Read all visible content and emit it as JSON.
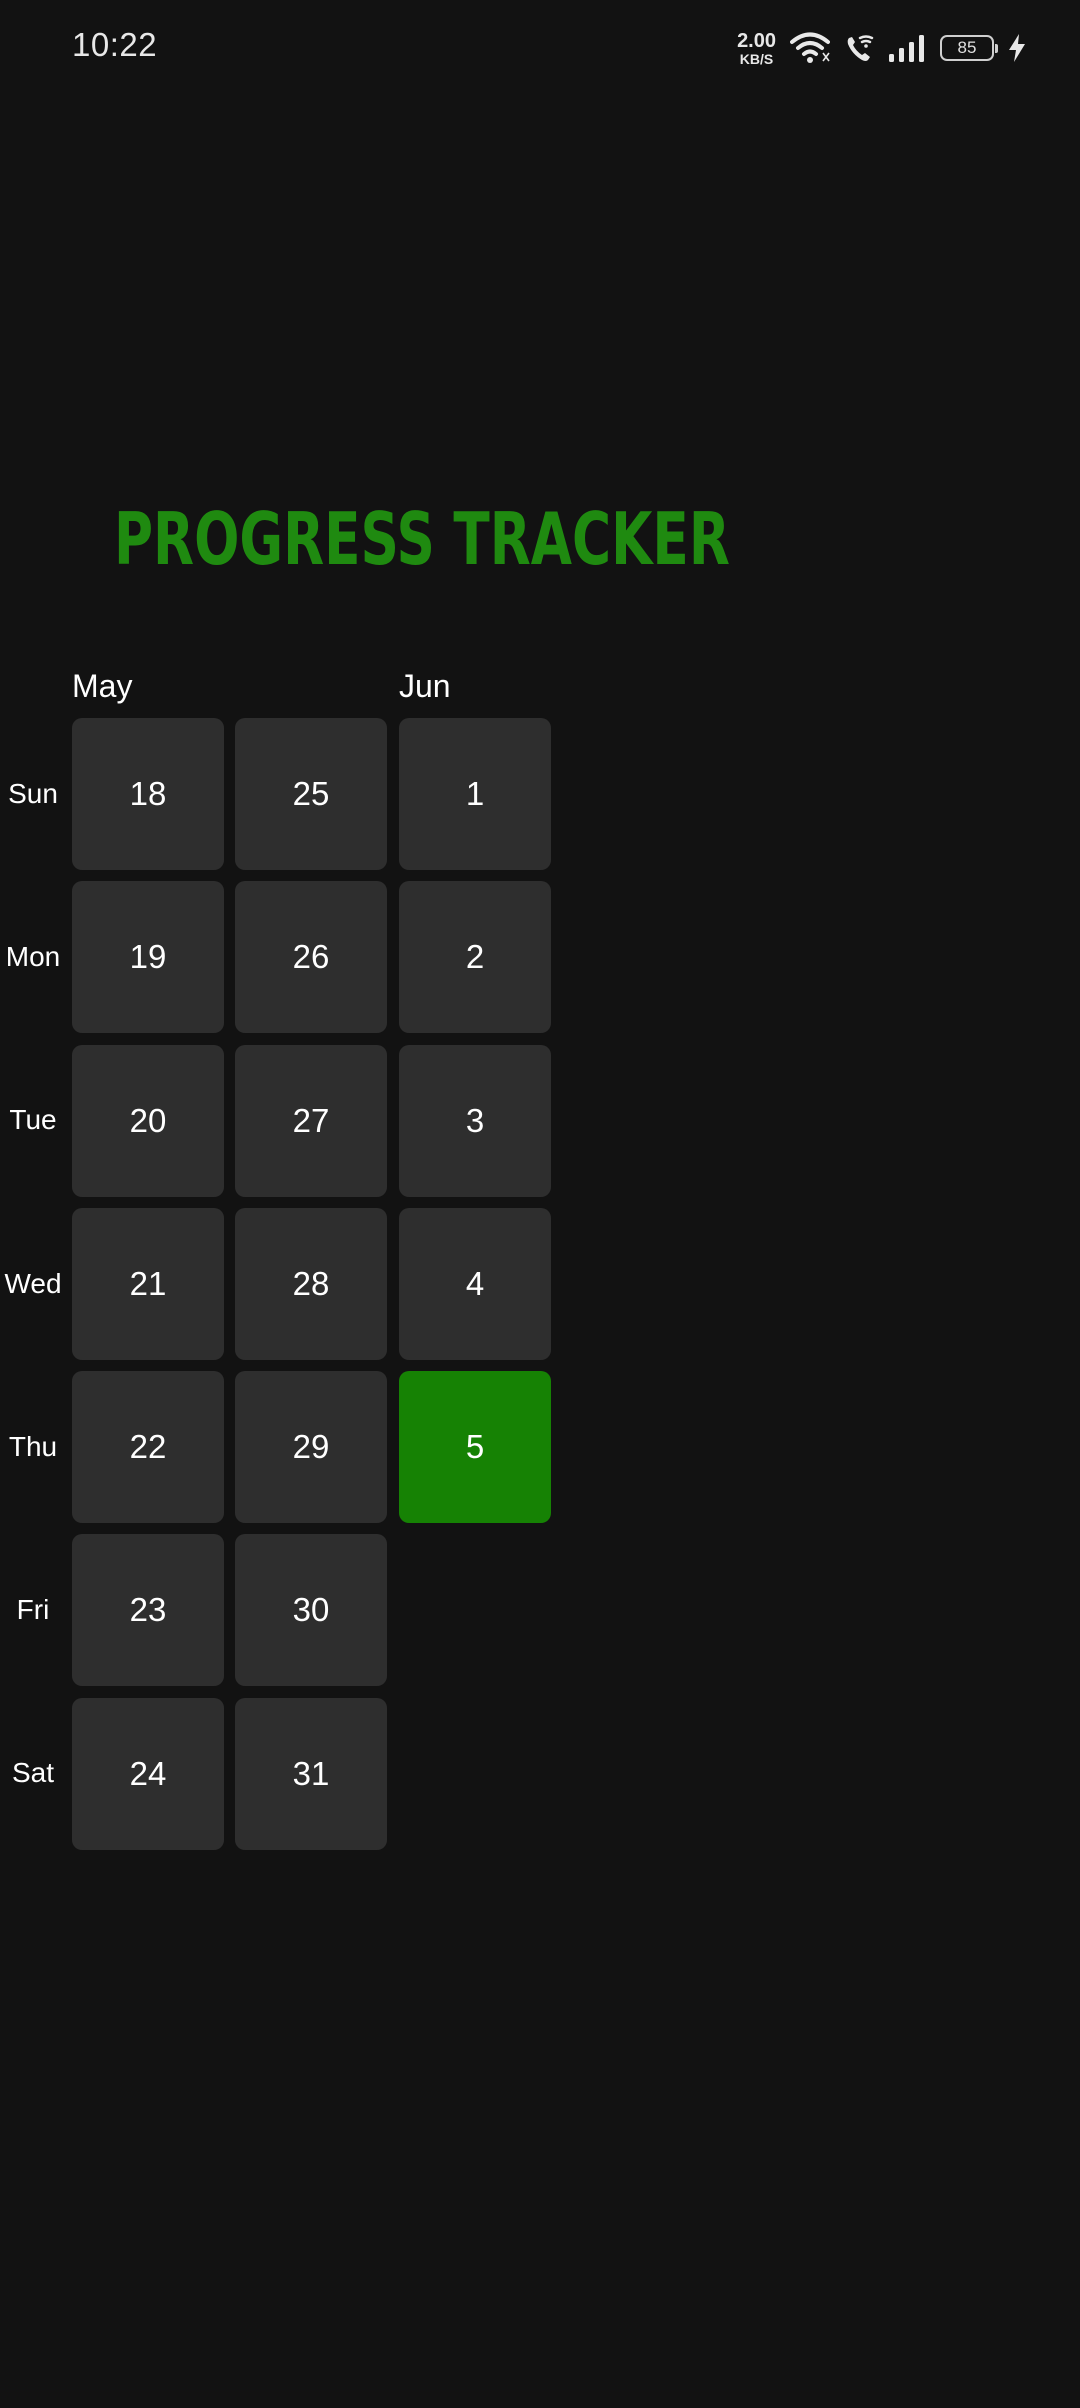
{
  "status_bar": {
    "time": "10:22",
    "net_speed_value": "2.00",
    "net_speed_unit": "KB/S",
    "battery_level": "85",
    "icons": [
      "wifi-icon",
      "wifi-calling-icon",
      "signal-icon",
      "battery-icon",
      "charging-icon"
    ]
  },
  "app": {
    "title": "PROGRESS TRACKER",
    "accent_color": "#1f8a10",
    "active_cell_color": "#168204",
    "cell_color": "#2e2e2e"
  },
  "calendar": {
    "months": [
      {
        "label": "May"
      },
      {
        "label": "Jun"
      }
    ],
    "weekdays": [
      "Sun",
      "Mon",
      "Tue",
      "Wed",
      "Thu",
      "Fri",
      "Sat"
    ],
    "weeks": [
      {
        "days": [
          "18",
          "19",
          "20",
          "21",
          "22",
          "23",
          "24"
        ]
      },
      {
        "days": [
          "25",
          "26",
          "27",
          "28",
          "29",
          "30",
          "31"
        ]
      },
      {
        "days": [
          "1",
          "2",
          "3",
          "4",
          "5"
        ]
      }
    ],
    "active_day": "5"
  }
}
